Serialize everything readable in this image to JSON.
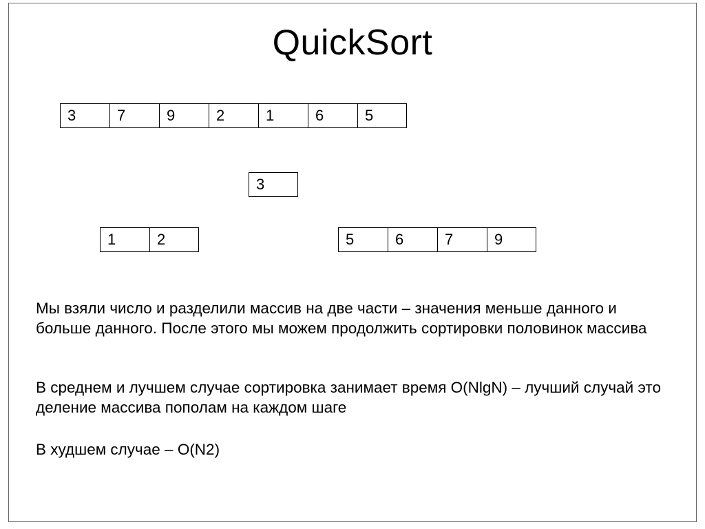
{
  "title": "QuickSort",
  "chart_data": {
    "type": "table",
    "groups": [
      {
        "id": "initial",
        "cells": [
          "3",
          "7",
          "9",
          "2",
          "1",
          "6",
          "5"
        ]
      },
      {
        "id": "pivot",
        "cells": [
          "3"
        ]
      },
      {
        "id": "left",
        "cells": [
          "1",
          "2"
        ]
      },
      {
        "id": "right",
        "cells": [
          "5",
          "6",
          "7",
          "9"
        ]
      }
    ]
  },
  "paragraphs": {
    "p1": "Мы взяли число и разделили массив на две части – значения меньше данного и больше данного. После этого мы можем продолжить сортировки половинок массива",
    "p2": "В среднем и лучшем случае сортировка занимает время O(NlgN) – лучший случай это деление массива пополам на каждом шаге",
    "p3": "В худшем случае – O(N2)"
  }
}
